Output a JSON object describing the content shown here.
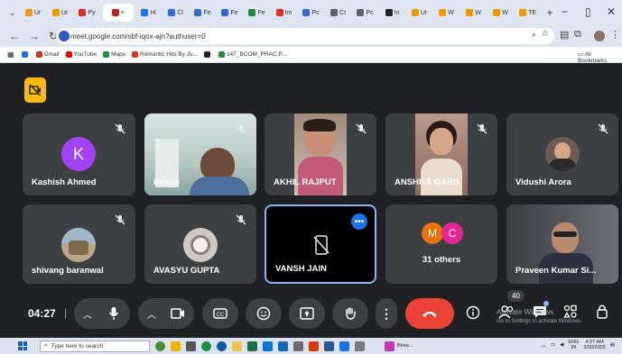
{
  "browser": {
    "tabs": [
      {
        "label": "Ur",
        "color": "#f29900"
      },
      {
        "label": "Ur",
        "color": "#f29900"
      },
      {
        "label": "Py",
        "color": "#d93025"
      },
      {
        "label": "×",
        "color": "#c5221f",
        "active": true
      },
      {
        "label": "Hi",
        "color": "#1a73e8"
      },
      {
        "label": "Cl",
        "color": "#3367d6"
      },
      {
        "label": "Fe",
        "color": "#3367d6"
      },
      {
        "label": "Fe",
        "color": "#3367d6"
      },
      {
        "label": "Fe",
        "color": "#1e8e3e"
      },
      {
        "label": "Im",
        "color": "#d93025"
      },
      {
        "label": "Pc",
        "color": "#3367d6"
      },
      {
        "label": "Ct",
        "color": "#5f6368"
      },
      {
        "label": "Pc",
        "color": "#5f6368"
      },
      {
        "label": "In",
        "color": "#202124"
      },
      {
        "label": "Ur",
        "color": "#f29900"
      },
      {
        "label": "W",
        "color": "#f29900"
      },
      {
        "label": "W",
        "color": "#f29900"
      },
      {
        "label": "W",
        "color": "#f29900"
      },
      {
        "label": "TE",
        "color": "#f29900"
      }
    ],
    "new_tab": "+",
    "window_controls": {
      "minimize": "−",
      "maximize": "▯",
      "close": "✕"
    },
    "url": "meet.google.com/sbf-iqox-ajn?authuser=0",
    "bookmarks": [
      {
        "label": "",
        "color": "#1a73e8"
      },
      {
        "label": "Gmail",
        "color": "#d93025"
      },
      {
        "label": "YouTube",
        "color": "#ff0000"
      },
      {
        "label": "Maps",
        "color": "#1e8e3e"
      },
      {
        "label": "Romantic Hits By Ju...",
        "color": "#d93025"
      },
      {
        "label": "",
        "color": "#202124"
      },
      {
        "label": "147_BCOM_PRAC.P...",
        "color": "#1e8e3e"
      }
    ],
    "all_bookmarks": "All Bookmarks"
  },
  "meet": {
    "participants": [
      {
        "name": "Kashish Ahmed",
        "avatar_letter": "K",
        "avatar_color": "#a142f4"
      },
      {
        "name": "Prince"
      },
      {
        "name": "AKHIL RAJPUT"
      },
      {
        "name": "ANSHITA GARG"
      },
      {
        "name": "Vidushi Arora"
      },
      {
        "name": "shivang baranwal"
      },
      {
        "name": "AVASYU GUPTA"
      },
      {
        "name": "VANSH JAIN"
      },
      {
        "name": "31 others",
        "avatars": [
          "M",
          "C"
        ],
        "avatar_colors": [
          "#e8710a",
          "#e52592"
        ]
      },
      {
        "name": "Praveen Kumar Si..."
      }
    ],
    "more_label": "•••",
    "time": "04:27",
    "participant_count": "40",
    "watermark": {
      "line1": "Activate Windows",
      "line2": "Go to Settings to activate Windows."
    }
  },
  "taskbar": {
    "search_placeholder": "Type here to search",
    "tray": {
      "lang": "ENG",
      "region": "IN",
      "time": "4:27 AM",
      "date": "3/20/2025"
    },
    "taskbar_item": "Bhea..."
  }
}
